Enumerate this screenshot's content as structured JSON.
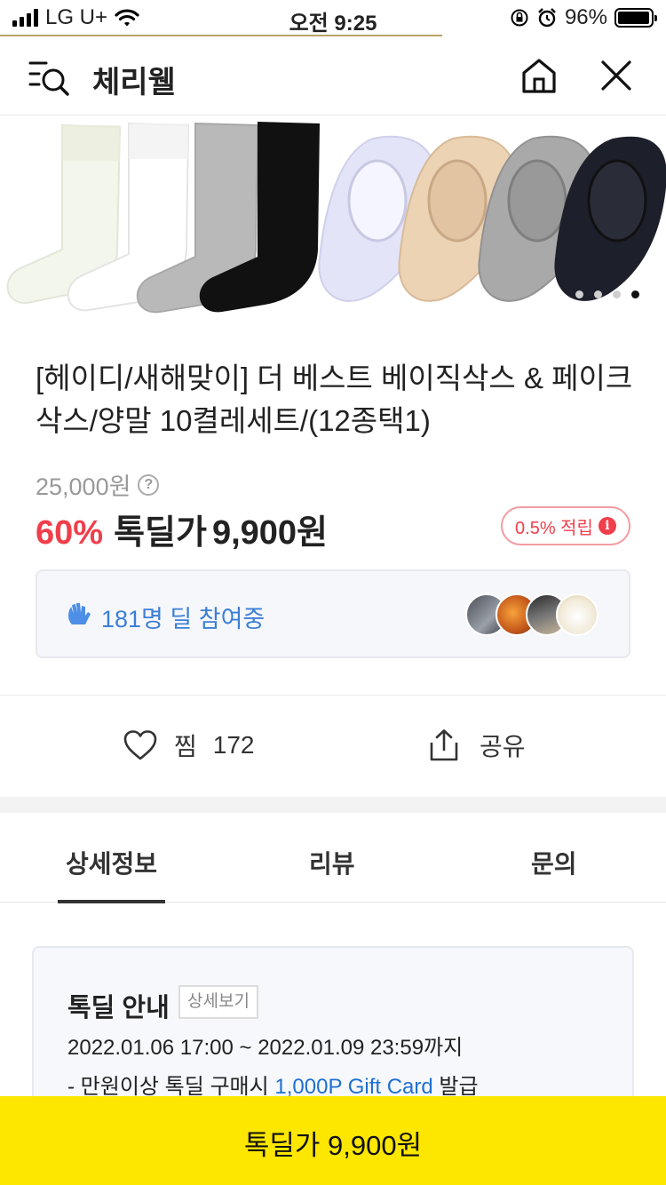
{
  "status_bar": {
    "carrier": "LG U+",
    "time": "오전 9:25",
    "battery": "96%",
    "battery_level": 0.96
  },
  "header": {
    "title": "체리웰",
    "icons": [
      "menu-search-icon",
      "home-icon",
      "close-icon"
    ]
  },
  "gallery": {
    "image_count": 4,
    "active_index": 3
  },
  "product": {
    "title": "[헤이디/새해맞이] 더 베스트 베이직삭스 & 페이크삭스/양말 10켤레세트/(12종택1)",
    "original_price": "25,000원",
    "discount": "60%",
    "deal_label": "톡딜가",
    "deal_price": "9,900원",
    "points": "0.5% 적립"
  },
  "participation": {
    "text": "181명 딜 참여중"
  },
  "actions": {
    "like_label": "찜",
    "like_count": "172",
    "share_label": "공유"
  },
  "tabs": [
    {
      "label": "상세정보",
      "active": true
    },
    {
      "label": "리뷰",
      "active": false
    },
    {
      "label": "문의",
      "active": false
    }
  ],
  "notice": {
    "title": "톡딜 안내",
    "detail_button": "상세보기",
    "period": "2022.01.06 17:00 ~ 2022.01.09 23:59까지",
    "benefit_prefix": "- 만원이상 톡딜 구매시 ",
    "benefit_highlight": "1,000P Gift Card",
    "benefit_suffix": " 발급"
  },
  "buy_bar": {
    "label": "톡딜가 9,900원"
  },
  "colors": {
    "accent_red": "#f03e4b",
    "accent_blue": "#3b7fd6",
    "buy_yellow": "#fde700"
  }
}
